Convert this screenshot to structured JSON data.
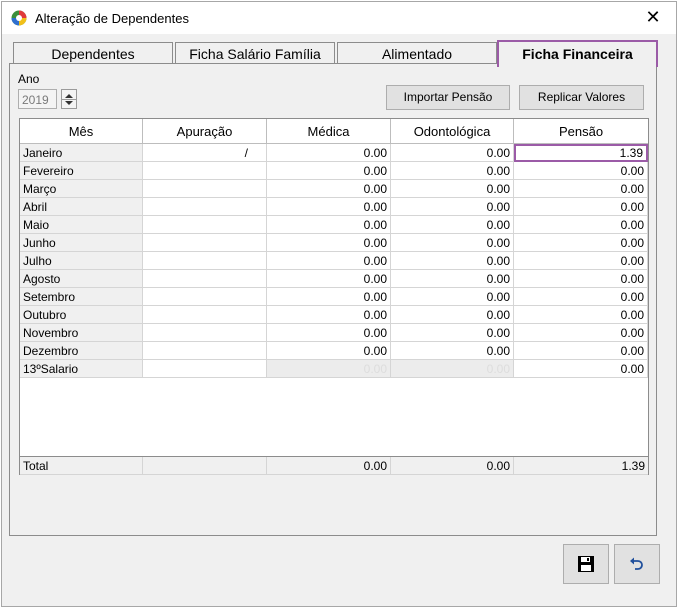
{
  "window": {
    "title": "Alteração de Dependentes",
    "close_glyph": "✕",
    "app_icon": "app-logo-icon"
  },
  "tabs": [
    {
      "label": "Dependentes",
      "active": false
    },
    {
      "label": "Ficha Salário Família",
      "active": false
    },
    {
      "label": "Alimentado",
      "active": false
    },
    {
      "label": "Ficha Financeira",
      "active": true
    }
  ],
  "year": {
    "label": "Ano",
    "value": "2019"
  },
  "buttons": {
    "import": "Importar Pensão",
    "replicate": "Replicar Valores"
  },
  "grid": {
    "columns": [
      "Mês",
      "Apuração",
      "Médica",
      "Odontológica",
      "Pensão"
    ],
    "rows": [
      {
        "month": "Janeiro",
        "apuracao": "/",
        "medica": "0.00",
        "odonto": "0.00",
        "pensao": "1.39"
      },
      {
        "month": "Fevereiro",
        "apuracao": "",
        "medica": "0.00",
        "odonto": "0.00",
        "pensao": "0.00"
      },
      {
        "month": "Março",
        "apuracao": "",
        "medica": "0.00",
        "odonto": "0.00",
        "pensao": "0.00"
      },
      {
        "month": "Abril",
        "apuracao": "",
        "medica": "0.00",
        "odonto": "0.00",
        "pensao": "0.00"
      },
      {
        "month": "Maio",
        "apuracao": "",
        "medica": "0.00",
        "odonto": "0.00",
        "pensao": "0.00"
      },
      {
        "month": "Junho",
        "apuracao": "",
        "medica": "0.00",
        "odonto": "0.00",
        "pensao": "0.00"
      },
      {
        "month": "Julho",
        "apuracao": "",
        "medica": "0.00",
        "odonto": "0.00",
        "pensao": "0.00"
      },
      {
        "month": "Agosto",
        "apuracao": "",
        "medica": "0.00",
        "odonto": "0.00",
        "pensao": "0.00"
      },
      {
        "month": "Setembro",
        "apuracao": "",
        "medica": "0.00",
        "odonto": "0.00",
        "pensao": "0.00"
      },
      {
        "month": "Outubro",
        "apuracao": "",
        "medica": "0.00",
        "odonto": "0.00",
        "pensao": "0.00"
      },
      {
        "month": "Novembro",
        "apuracao": "",
        "medica": "0.00",
        "odonto": "0.00",
        "pensao": "0.00"
      },
      {
        "month": "Dezembro",
        "apuracao": "",
        "medica": "0.00",
        "odonto": "0.00",
        "pensao": "0.00"
      },
      {
        "month": "13ºSalario",
        "apuracao": "",
        "medica": "0.00",
        "odonto": "0.00",
        "pensao": "0.00"
      }
    ],
    "total": {
      "label": "Total",
      "apuracao": "",
      "medica": "0.00",
      "odonto": "0.00",
      "pensao": "1.39"
    }
  },
  "footer": {
    "save_icon": "save-icon",
    "undo_icon": "undo-icon"
  }
}
